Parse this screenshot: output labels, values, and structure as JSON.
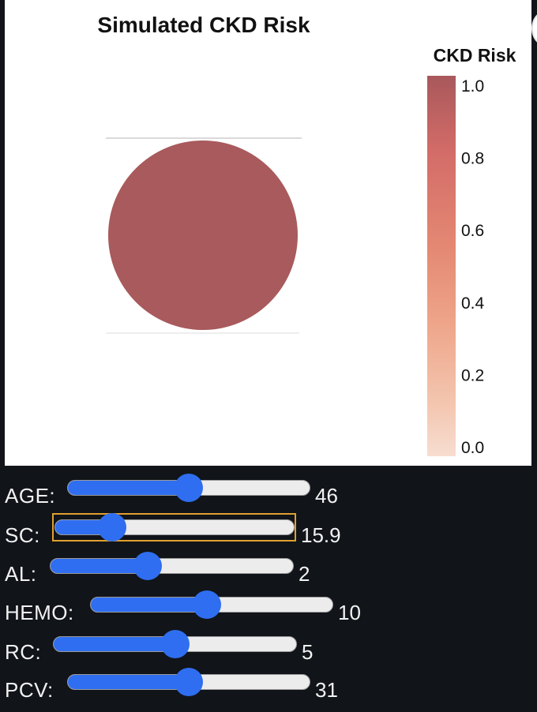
{
  "figure": {
    "title": "Simulated CKD Risk",
    "colorbar": {
      "title": "CKD Risk",
      "ticks": [
        "1.0",
        "0.8",
        "0.6",
        "0.4",
        "0.2",
        "0.0"
      ],
      "colors": {
        "top": "#a8585b",
        "mid_high": "#d36c68",
        "mid": "#e48873",
        "mid_low": "#eea58a",
        "low": "#f3c4ad",
        "bottom": "#f7ddd0"
      }
    },
    "marker_color": "#a85a5c"
  },
  "chart_data": {
    "type": "scatter",
    "title": "Simulated CKD Risk",
    "points": [
      {
        "risk": 1.0
      }
    ],
    "colorbar": {
      "title": "CKD Risk",
      "range": [
        0.0,
        1.0
      ]
    },
    "grid": false,
    "legend": "right"
  },
  "sliders": [
    {
      "label": "AGE:",
      "value": "46",
      "fraction": 0.5
    },
    {
      "label": "SC:",
      "value": "15.9",
      "fraction": 0.24
    },
    {
      "label": "AL:",
      "value": "2",
      "fraction": 0.4
    },
    {
      "label": "HEMO:",
      "value": "10",
      "fraction": 0.48
    },
    {
      "label": "RC:",
      "value": "5",
      "fraction": 0.5
    },
    {
      "label": "PCV:",
      "value": "31",
      "fraction": 0.5
    }
  ],
  "colors": {
    "accent": "#2f6ef0",
    "focus": "#e0a02f",
    "background": "#111419"
  }
}
